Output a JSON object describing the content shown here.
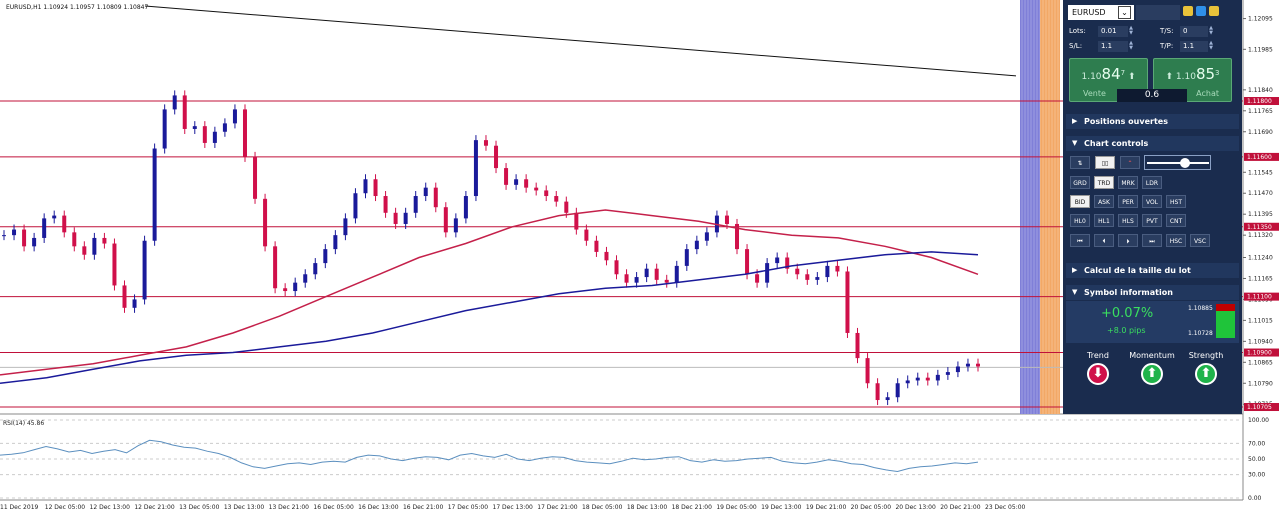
{
  "header": {
    "symbol_info": "EURUSD,H1  1.10924 1.10957 1.10809 1.10847"
  },
  "chart_data": {
    "type": "candlestick",
    "symbol": "EURUSD",
    "timeframe": "H1",
    "ohlc_header": [
      1.10924,
      1.10957,
      1.10809,
      1.10847
    ],
    "y_ticks": [
      "1.12095",
      "1.11985",
      "1.11840",
      "1.11765",
      "1.11690",
      "1.11545",
      "1.11470",
      "1.11395",
      "1.11320",
      "1.11240",
      "1.11165",
      "1.11090",
      "1.11015",
      "1.10940",
      "1.10865",
      "1.10790",
      "1.10715"
    ],
    "ylim": [
      1.1068,
      1.1214
    ],
    "levels": [
      {
        "price": 1.118,
        "label": "1.11800"
      },
      {
        "price": 1.116,
        "label": "1.11600"
      },
      {
        "price": 1.1135,
        "label": "1.11350"
      },
      {
        "price": 1.111,
        "label": "1.11100"
      },
      {
        "price": 1.109,
        "label": "1.10900"
      },
      {
        "price": 1.10705,
        "label": "1.10705"
      }
    ],
    "bid_label": "1.10847",
    "x_labels": [
      "11 Dec 2019",
      "12 Dec 05:00",
      "12 Dec 13:00",
      "12 Dec 21:00",
      "13 Dec 05:00",
      "13 Dec 13:00",
      "13 Dec 21:00",
      "16 Dec 05:00",
      "16 Dec 13:00",
      "16 Dec 21:00",
      "17 Dec 05:00",
      "17 Dec 13:00",
      "17 Dec 21:00",
      "18 Dec 05:00",
      "18 Dec 13:00",
      "18 Dec 21:00",
      "19 Dec 05:00",
      "19 Dec 13:00",
      "19 Dec 21:00",
      "20 Dec 05:00",
      "20 Dec 13:00",
      "20 Dec 21:00",
      "23 Dec 05:00"
    ],
    "close_path": [
      1.1132,
      1.1134,
      1.1128,
      1.1131,
      1.1138,
      1.1139,
      1.1133,
      1.1128,
      1.1125,
      1.1131,
      1.1129,
      1.1114,
      1.1106,
      1.1109,
      1.113,
      1.1163,
      1.1177,
      1.1182,
      1.117,
      1.1171,
      1.1165,
      1.1169,
      1.1172,
      1.1177,
      1.116,
      1.1145,
      1.1128,
      1.1113,
      1.1112,
      1.1115,
      1.1118,
      1.1122,
      1.1127,
      1.1132,
      1.1138,
      1.1147,
      1.1152,
      1.1146,
      1.114,
      1.1136,
      1.114,
      1.1146,
      1.1149,
      1.1142,
      1.1133,
      1.1138,
      1.1146,
      1.1166,
      1.1164,
      1.1156,
      1.115,
      1.1152,
      1.1149,
      1.1148,
      1.1146,
      1.1144,
      1.114,
      1.1134,
      1.113,
      1.1126,
      1.1123,
      1.1118,
      1.1115,
      1.1117,
      1.112,
      1.1116,
      1.1115,
      1.1121,
      1.1127,
      1.113,
      1.1133,
      1.1139,
      1.1136,
      1.1127,
      1.1118,
      1.1115,
      1.1122,
      1.1124,
      1.112,
      1.1118,
      1.1116,
      1.1117,
      1.1121,
      1.1119,
      1.1097,
      1.1088,
      1.1079,
      1.1073,
      1.1074,
      1.1079,
      1.108,
      1.1081,
      1.108,
      1.1082,
      1.1083,
      1.1085,
      1.1086,
      1.1085
    ],
    "ma_fast": [
      1.1082,
      1.1084,
      1.1086,
      1.1089,
      1.1092,
      1.1097,
      1.1103,
      1.111,
      1.1117,
      1.1124,
      1.1129,
      1.1135,
      1.1139,
      1.1141,
      1.1139,
      1.1137,
      1.1134,
      1.1132,
      1.1131,
      1.1128,
      1.1124,
      1.1118
    ],
    "ma_slow": [
      1.1079,
      1.1081,
      1.1084,
      1.1087,
      1.1089,
      1.109,
      1.1092,
      1.1094,
      1.1097,
      1.1101,
      1.1105,
      1.1108,
      1.1111,
      1.1113,
      1.1114,
      1.1116,
      1.1118,
      1.1121,
      1.1123,
      1.1125,
      1.1126,
      1.1125
    ],
    "trendline": {
      "from": 1.1214,
      "to": 1.1189
    },
    "rsi": {
      "label": "RSI(14) 45.86",
      "ticks": [
        "100.00",
        "70.00",
        "50.00",
        "30.00",
        "0.00"
      ],
      "values": [
        55,
        56,
        58,
        62,
        66,
        63,
        59,
        61,
        57,
        60,
        62,
        58,
        67,
        74,
        72,
        68,
        65,
        64,
        60,
        57,
        52,
        45,
        40,
        38,
        41,
        44,
        45,
        43,
        46,
        47,
        46,
        52,
        55,
        54,
        50,
        48,
        51,
        53,
        52,
        49,
        55,
        57,
        54,
        52,
        56,
        50,
        48,
        51,
        53,
        52,
        48,
        46,
        45,
        44,
        47,
        51,
        49,
        50,
        52,
        53,
        48,
        46,
        49,
        47,
        48,
        50,
        51,
        52,
        47,
        45,
        44,
        46,
        49,
        47,
        44,
        43,
        39,
        36,
        34,
        38,
        40,
        41,
        43,
        45,
        44,
        46
      ]
    }
  },
  "panel": {
    "symbol": "EURUSD",
    "lots_label": "Lots:",
    "lots_value": "0.01",
    "sl_label": "S/L:",
    "sl_value": "1.1",
    "ts_label": "T/S:",
    "ts_value": "0",
    "tp_label": "T/P:",
    "tp_value": "1.1",
    "sell_prefix": "1.10",
    "sell_big": "84",
    "sell_sup": "7",
    "sell_label": "Vente",
    "buy_prefix": "1.10",
    "buy_big": "85",
    "buy_sup": "3",
    "buy_label": "Achat",
    "spread": "0.6",
    "sections": {
      "positions": "Positions ouvertes",
      "chart_controls": "Chart controls",
      "lot_calc": "Calcul de la taille du lot",
      "symbol_info": "Symbol information"
    },
    "buttons_row2": [
      "GRD",
      "TRD",
      "MRK",
      "LDR"
    ],
    "buttons_row3": [
      "BID",
      "ASK",
      "PER",
      "VOL",
      "HST"
    ],
    "buttons_row4": [
      "HL0",
      "HL1",
      "HLS",
      "PVT",
      "CNT"
    ],
    "buttons_row5": [
      "⏮",
      "⏴",
      "⏵",
      "⏭",
      "HSC",
      "VSC"
    ],
    "change_pct": "+0.07%",
    "change_pips": "+8.0 pips",
    "high": "1.10885",
    "low": "1.10728",
    "indicators": [
      "Trend",
      "Momentum",
      "Strength"
    ],
    "colors": {
      "panel_bg": "#1a2c4e",
      "buy_green": "#2e7d4f",
      "up": "#1fb34a",
      "down": "#d0104a"
    }
  }
}
